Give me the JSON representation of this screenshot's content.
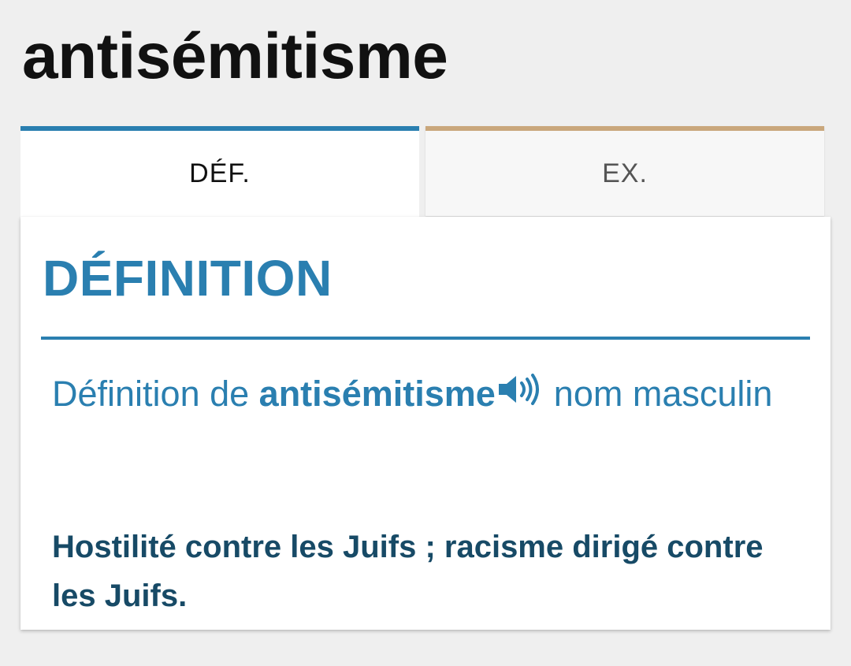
{
  "entry": {
    "word": "antisémitisme"
  },
  "tabs": [
    {
      "label": "DÉF.",
      "active": true
    },
    {
      "label": "EX.",
      "active": false
    }
  ],
  "definition": {
    "heading": "DÉFINITION",
    "prefix": "Définition de ",
    "word": "antisémitisme",
    "audio_icon": "speaker-icon",
    "category": "nom masculin",
    "text": "Hostilité contre les Juifs ; racisme dirigé contre les Juifs."
  },
  "colors": {
    "accent_blue": "#2a7fb0",
    "accent_tan": "#c9a77c",
    "definition_text": "#174a66",
    "background": "#efefef"
  }
}
